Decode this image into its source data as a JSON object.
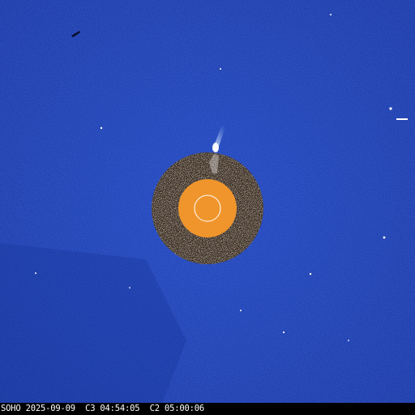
{
  "image": {
    "caption": "SOHO 2025-09-09  C3 04:54:05  C2 05:00:06",
    "colors": {
      "sky": "#1a3fb0",
      "sky_dark": "#0f2a8c",
      "occulter": "#f0952c",
      "c2_ring": "#c9b79e",
      "c2_ring_dark": "#3a2a1a",
      "sun_outline": "#ffffff",
      "caption_bg": "#000000",
      "caption_text": "#ffffff"
    },
    "features": [
      "coronagraph-field",
      "c2-annulus",
      "occulter-disk",
      "sun-limb-circle",
      "comet-streak",
      "stars"
    ]
  }
}
